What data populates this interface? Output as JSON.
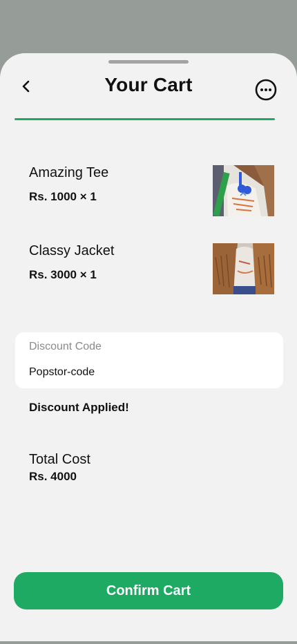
{
  "colors": {
    "backdrop": "#969c97",
    "sheet": "#f2f2f2",
    "accent": "#1eaa63",
    "grabber": "#a3a3a3",
    "text": "#111111",
    "muted": "#8a8a8a"
  },
  "header": {
    "title": "Your Cart",
    "back_icon": "chevron-left-icon",
    "more_icon": "more-horizontal-icon"
  },
  "cart": {
    "items": [
      {
        "name": "Amazing Tee",
        "price": "Rs. 1000 × 1",
        "thumbnail": "tee-photo"
      },
      {
        "name": "Classy Jacket",
        "price": "Rs. 3000 × 1",
        "thumbnail": "jacket-photo"
      }
    ]
  },
  "discount": {
    "label": "Discount Code",
    "code": "Popstor-code",
    "status": "Discount Applied!"
  },
  "total": {
    "label": "Total Cost",
    "value": "Rs. 4000"
  },
  "actions": {
    "confirm_label": "Confirm Cart"
  }
}
